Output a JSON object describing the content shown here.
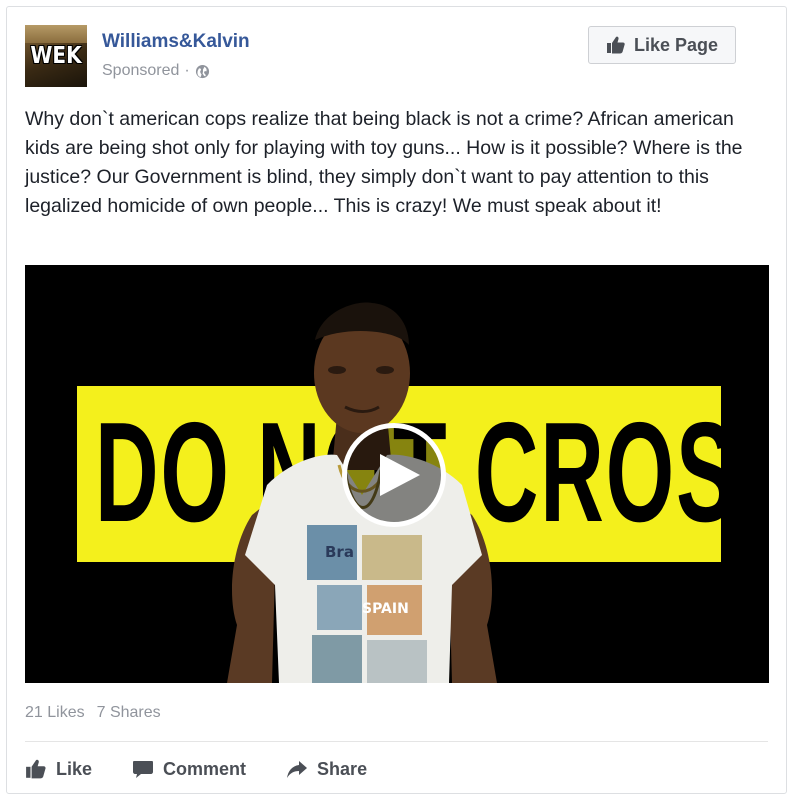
{
  "post": {
    "page_name": "Williams&Kalvin",
    "avatar_text": "WEK",
    "sponsored_label": "Sponsored",
    "meta_separator": "·",
    "like_page_label": "Like Page",
    "text": "Why don`t american cops realize that being black is not a crime? African american kids are being shot only for playing with toy guns... How is it possible? Where is the justice? Our Government is blind, they simply don`t want to pay attention to this legalized homicide of own people... This is crazy! We must speak about it!"
  },
  "video": {
    "tape_text": "DO NOT CROSS",
    "shirt_word_top": "Bra",
    "shirt_word_mid": "SPAIN"
  },
  "stats": {
    "likes": "21 Likes",
    "shares": "7 Shares"
  },
  "actions": {
    "like_label": "Like",
    "comment_label": "Comment",
    "share_label": "Share"
  },
  "colors": {
    "link_blue": "#365899",
    "muted": "#90949c",
    "button_text": "#4b4f56",
    "tape_yellow": "#f4f01c"
  },
  "icons": [
    "globe-icon",
    "thumbs-up-icon",
    "play-icon",
    "comment-icon",
    "share-icon"
  ]
}
